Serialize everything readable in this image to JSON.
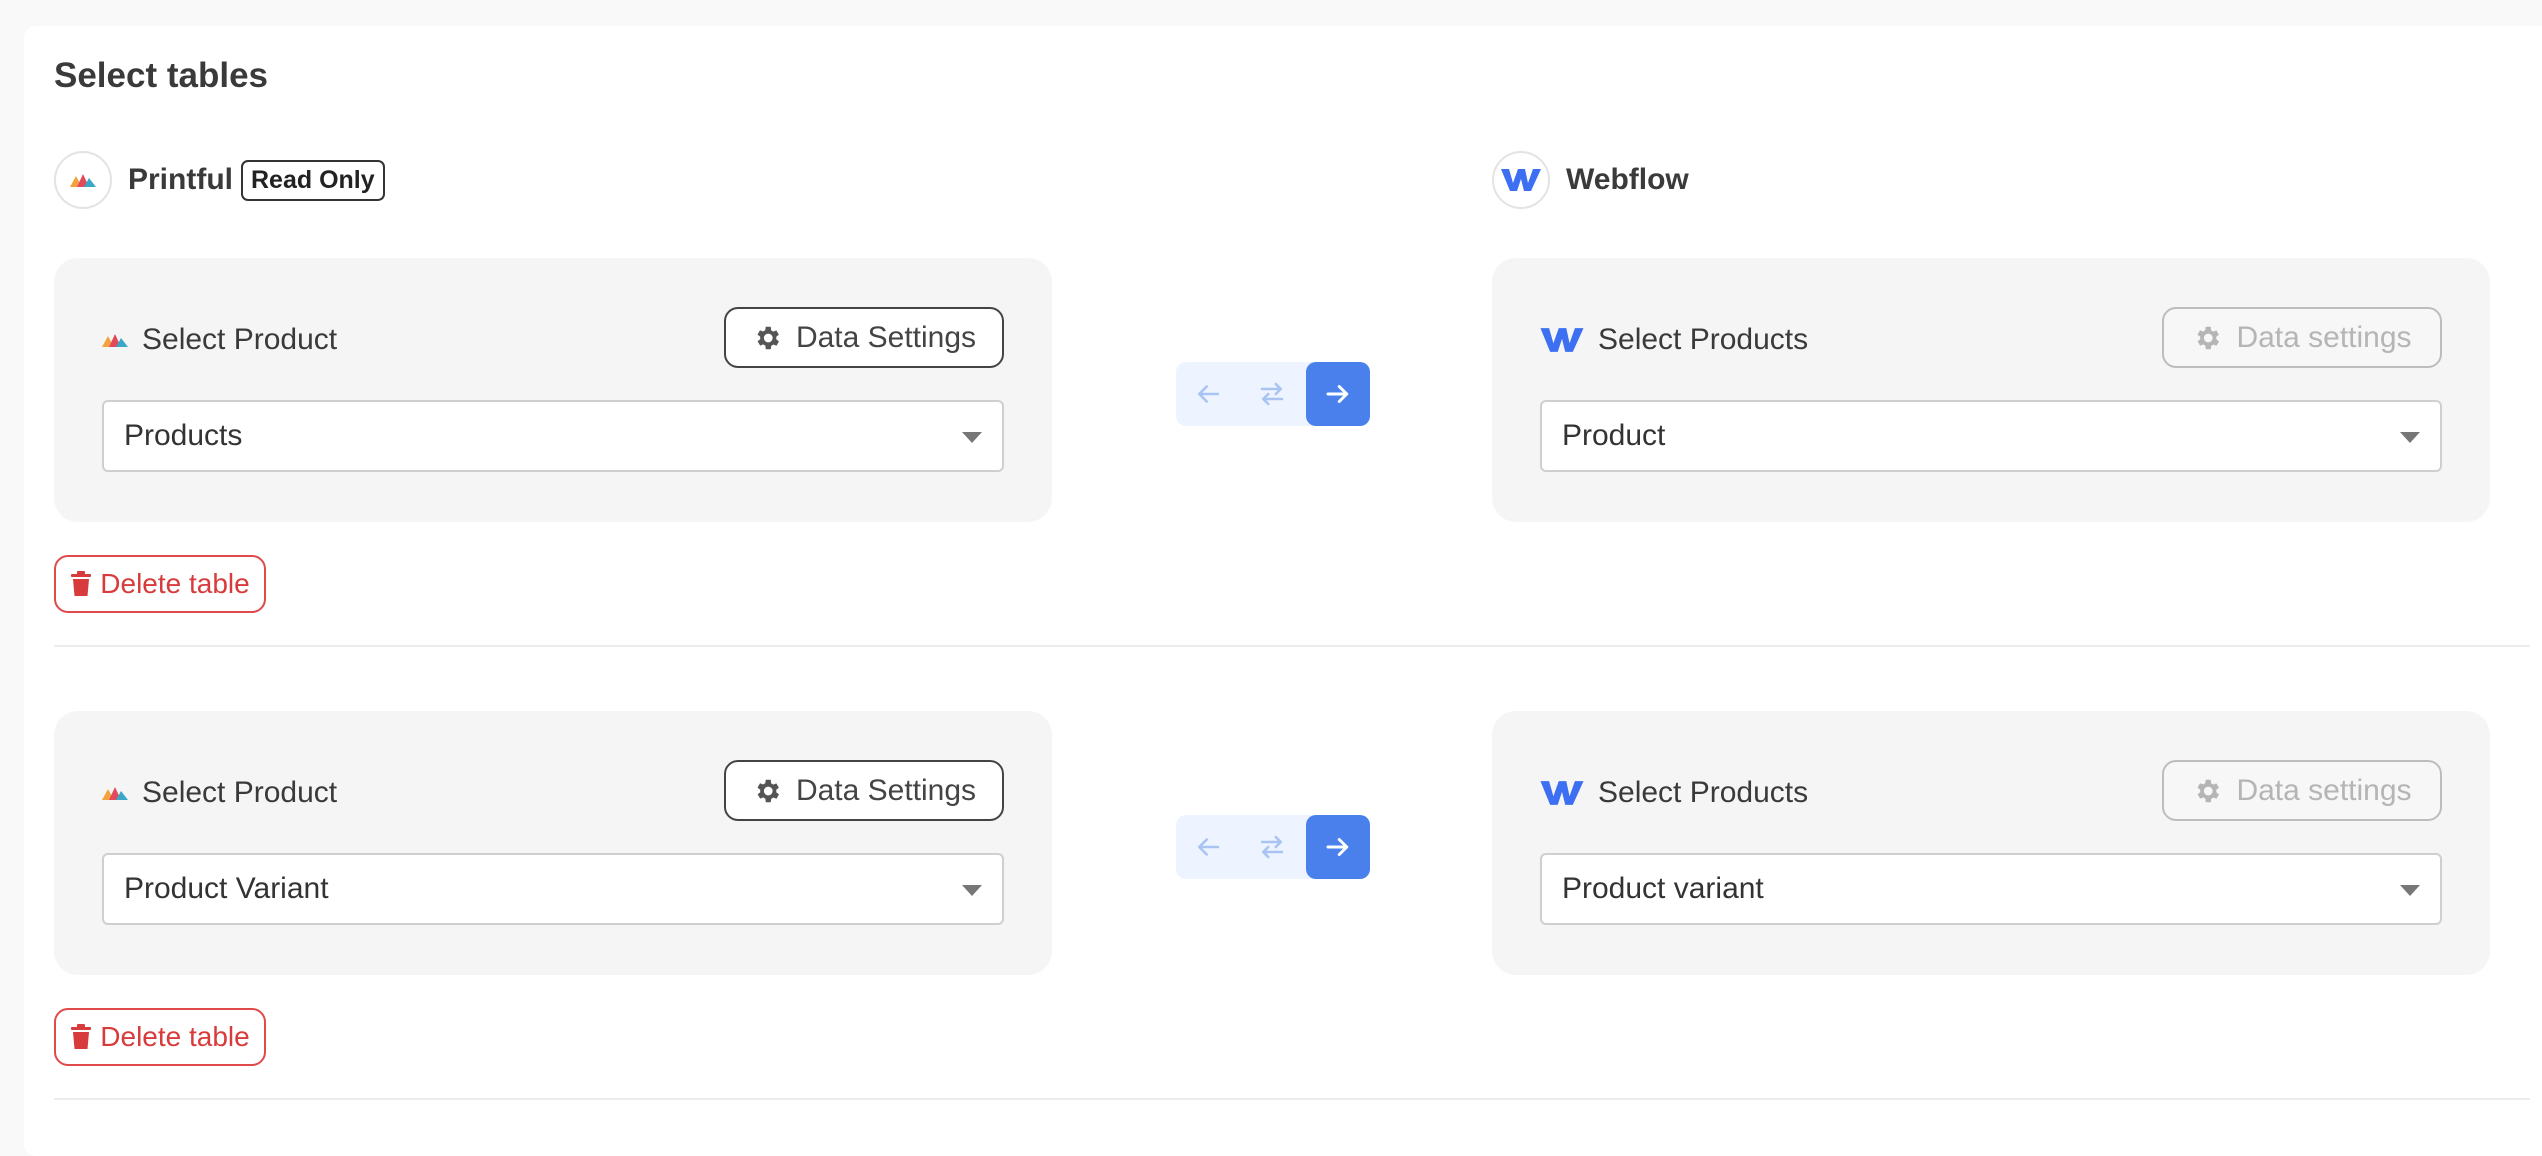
{
  "page_title": "Select tables",
  "source_app": {
    "name": "Printful",
    "badge": "Read Only",
    "icon": "printful-logo-icon"
  },
  "target_app": {
    "name": "Webflow",
    "icon": "webflow-logo-icon"
  },
  "mappings": [
    {
      "source": {
        "label": "Select Product",
        "settings_label": "Data Settings",
        "selected": "Products"
      },
      "target": {
        "label": "Select Products",
        "settings_label": "Data settings",
        "selected": "Product"
      },
      "direction": "left-to-right",
      "delete_label": "Delete table"
    },
    {
      "source": {
        "label": "Select Product",
        "settings_label": "Data Settings",
        "selected": "Product Variant"
      },
      "target": {
        "label": "Select Products",
        "settings_label": "Data settings",
        "selected": "Product variant"
      },
      "direction": "left-to-right",
      "delete_label": "Delete table"
    }
  ],
  "colors": {
    "accent": "#4a80eb",
    "danger": "#d83b3b",
    "panel_bg": "#f5f5f5",
    "webflow": "#3d6ff2"
  }
}
